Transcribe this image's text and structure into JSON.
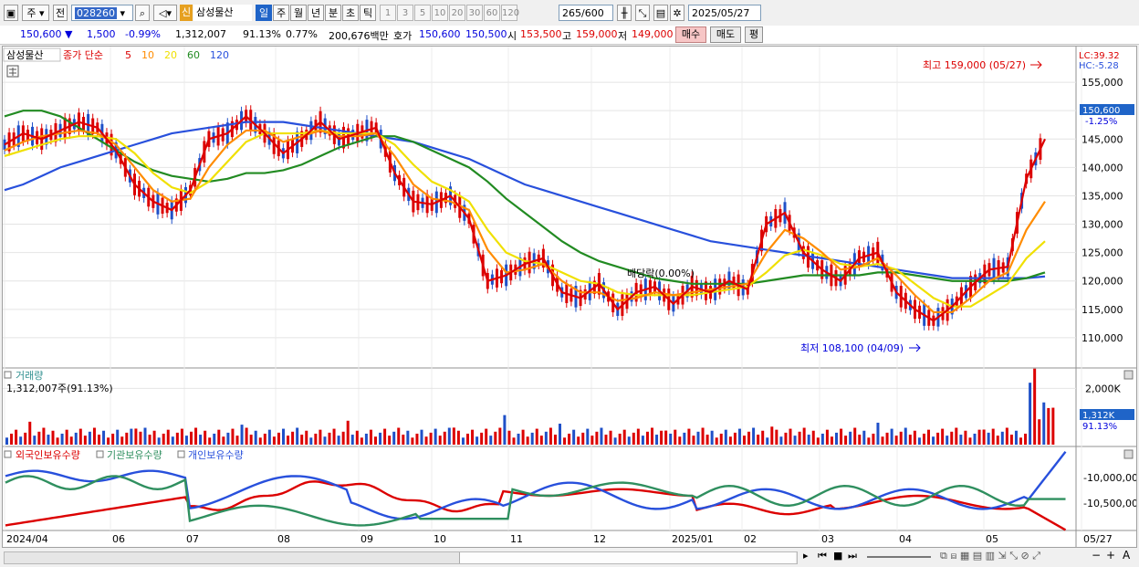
{
  "toolbar": {
    "menu1": "주",
    "menu2": "전",
    "stock_code": "028260",
    "shin_badge": "신",
    "stock_name": "삼성물산",
    "periods": [
      "일",
      "주",
      "월",
      "년",
      "분",
      "초",
      "틱"
    ],
    "active_period": "일",
    "minutes": [
      "1",
      "3",
      "5",
      "10",
      "20",
      "30",
      "60",
      "120"
    ],
    "count": "265",
    "count_total": "/600",
    "date": "2025/05/27"
  },
  "quote": {
    "price": "150,600",
    "change": "1,500",
    "change_pct": "-0.99%",
    "volume": "1,312,007",
    "vol_ratio": "91.13%",
    "turnover": "0.77%",
    "amount": "200,676백만",
    "ask_label": "호가",
    "ask": "150,600",
    "bid": "150,500",
    "open_label": "시",
    "open": "153,500",
    "high_label": "고",
    "high": "159,000",
    "low_label": "저",
    "low": "149,000",
    "buy_btn": "매수",
    "sell_btn": "매도",
    "eval_btn": "평"
  },
  "legend": {
    "name": "삼성물산",
    "ma_label": "종가 단순",
    "ma_periods": [
      "5",
      "10",
      "20",
      "60",
      "120"
    ],
    "colors": [
      "#dc0000",
      "#ff8c00",
      "#f0e000",
      "#228b22",
      "#2850dc"
    ]
  },
  "annotations": {
    "high": "최고 159,000 (05/27)",
    "low": "최저 108,100 (04/09)",
    "dividend": "배당락(0.00%)",
    "lc": "LC:39.32",
    "hc": "HC:-5.28",
    "price_tag": "150,600",
    "price_tag_pct": "-1.25%"
  },
  "volume_panel": {
    "title": "거래량",
    "value": "1,312,007주(91.13%)",
    "tag": "1,312K",
    "tag_pct": "91.13%"
  },
  "holding_panel": {
    "foreign": "외국인보유수량",
    "institution": "기관보유수량",
    "individual": "개인보유수량"
  },
  "chart_data": {
    "type": "line",
    "title": "삼성물산",
    "y_ticks": [
      "155,000",
      "150,000",
      "145,000",
      "140,000",
      "135,000",
      "130,000",
      "125,000",
      "120,000",
      "115,000",
      "110,000"
    ],
    "ylim": [
      105000,
      160000
    ],
    "x_labels": [
      "2024/04",
      "06",
      "07",
      "08",
      "09",
      "10",
      "11",
      "12",
      "2025/01",
      "02",
      "03",
      "04",
      "05",
      "05/27"
    ],
    "series": [
      {
        "name": "5",
        "color": "#dc0000",
        "values": [
          144000,
          146000,
          145000,
          146500,
          148000,
          147000,
          143000,
          137000,
          134000,
          132500,
          136000,
          145000,
          146000,
          149000,
          146000,
          142500,
          145000,
          148000,
          145000,
          146000,
          147000,
          139000,
          134000,
          133500,
          135000,
          131000,
          120000,
          121000,
          123000,
          124000,
          118000,
          117000,
          119500,
          115000,
          118000,
          119000,
          116000,
          119000,
          118000,
          120000,
          118500,
          130000,
          132000,
          125000,
          122000,
          120000,
          124000,
          125000,
          118000,
          115000,
          113000,
          115500,
          119000,
          122000,
          122500,
          138000,
          145000
        ]
      },
      {
        "name": "10",
        "color": "#ff8c00",
        "values": [
          143000,
          144500,
          145500,
          146000,
          146500,
          146000,
          144000,
          140000,
          136000,
          134000,
          134500,
          140000,
          144000,
          146500,
          146500,
          144500,
          145500,
          146500,
          145500,
          145500,
          146000,
          142000,
          137000,
          134500,
          134000,
          132500,
          125500,
          121500,
          122000,
          123000,
          120000,
          118000,
          118000,
          116500,
          117000,
          118000,
          117500,
          118000,
          118500,
          119000,
          119500,
          125000,
          129000,
          127500,
          125000,
          122000,
          122500,
          124000,
          121000,
          117500,
          114500,
          114500,
          117000,
          120000,
          121500,
          129000,
          134000
        ]
      },
      {
        "name": "20",
        "color": "#f0e000",
        "values": [
          142000,
          143000,
          144000,
          145000,
          145500,
          145500,
          145000,
          142500,
          139000,
          136500,
          135500,
          137500,
          141000,
          144500,
          146000,
          146000,
          146000,
          146500,
          146000,
          146000,
          146000,
          144000,
          140500,
          137500,
          136000,
          134000,
          129000,
          125000,
          123500,
          123000,
          121500,
          120000,
          119500,
          118000,
          117500,
          117500,
          117500,
          117500,
          118000,
          118500,
          119000,
          121500,
          124500,
          125500,
          124500,
          123000,
          122500,
          123000,
          122000,
          119500,
          117000,
          115500,
          115500,
          117500,
          119500,
          124000,
          127000
        ]
      },
      {
        "name": "60",
        "color": "#228b22",
        "values": [
          149000,
          150000,
          150000,
          149000,
          147000,
          145000,
          143000,
          141000,
          139500,
          138500,
          138000,
          137500,
          138000,
          139000,
          139000,
          139500,
          140500,
          142000,
          143500,
          144500,
          145500,
          145500,
          144500,
          143000,
          141500,
          140000,
          137500,
          134500,
          132000,
          129500,
          127000,
          125000,
          123500,
          122500,
          121500,
          120500,
          120000,
          119500,
          119500,
          119500,
          119500,
          120000,
          120500,
          121000,
          121000,
          121000,
          121000,
          121500,
          121500,
          121000,
          120500,
          120000,
          120000,
          120000,
          120000,
          120500,
          121500
        ]
      },
      {
        "name": "120",
        "color": "#2850dc",
        "values": [
          136000,
          137000,
          138500,
          140000,
          141000,
          142000,
          143000,
          144000,
          145000,
          146000,
          146500,
          147000,
          147500,
          148000,
          148000,
          148000,
          147500,
          147000,
          146500,
          146000,
          145500,
          145000,
          144500,
          143500,
          142500,
          141500,
          140000,
          138500,
          137000,
          136000,
          135000,
          134000,
          133000,
          132000,
          131000,
          130000,
          129000,
          128000,
          127000,
          126500,
          126000,
          125500,
          125000,
          124500,
          124000,
          123500,
          123000,
          122500,
          122000,
          121500,
          121000,
          120500,
          120500,
          120500,
          120500,
          120500,
          120800
        ]
      }
    ],
    "volume_yticks": [
      "2,000K"
    ],
    "holding_yticks": [
      "-10,000,00",
      "-10,500,00"
    ]
  }
}
